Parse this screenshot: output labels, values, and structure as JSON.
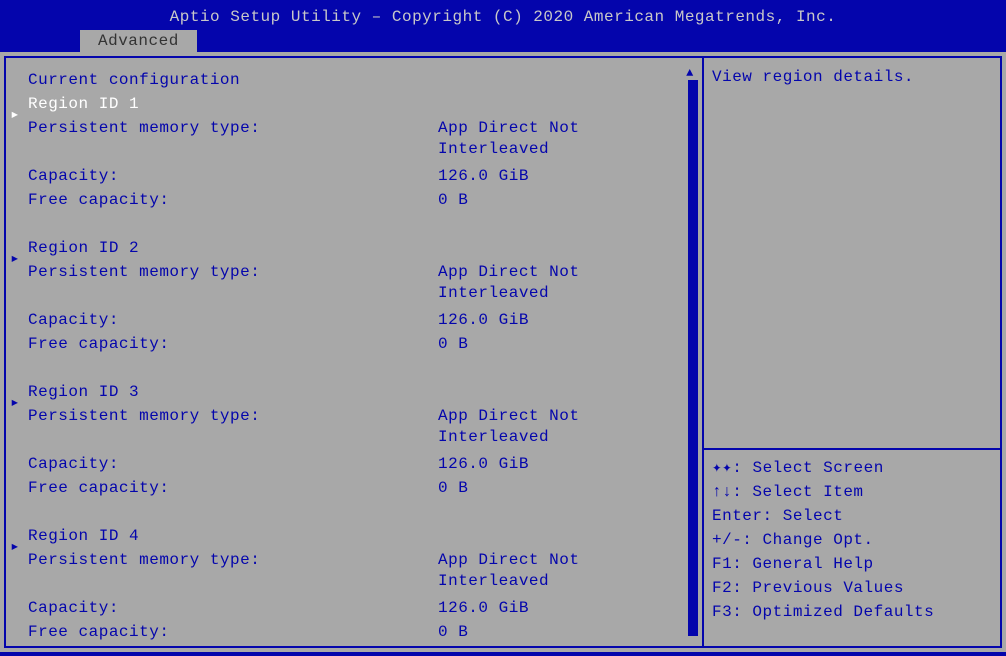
{
  "header": {
    "title": "Aptio Setup Utility – Copyright (C) 2020 American Megatrends, Inc."
  },
  "tab": {
    "label": "Advanced"
  },
  "content": {
    "section_title": "Current configuration",
    "regions": [
      {
        "id_label": "Region ID 1",
        "mem_type_label": "Persistent memory type:",
        "mem_type_value_l1": "App Direct Not",
        "mem_type_value_l2": "Interleaved",
        "capacity_label": "Capacity:",
        "capacity_value": "126.0 GiB",
        "free_label": "Free capacity:",
        "free_value": "0 B",
        "selected": true
      },
      {
        "id_label": "Region ID 2",
        "mem_type_label": "Persistent memory type:",
        "mem_type_value_l1": "App Direct Not",
        "mem_type_value_l2": "Interleaved",
        "capacity_label": "Capacity:",
        "capacity_value": "126.0 GiB",
        "free_label": "Free capacity:",
        "free_value": "0 B",
        "selected": false
      },
      {
        "id_label": "Region ID 3",
        "mem_type_label": "Persistent memory type:",
        "mem_type_value_l1": "App Direct Not",
        "mem_type_value_l2": "Interleaved",
        "capacity_label": "Capacity:",
        "capacity_value": "126.0 GiB",
        "free_label": "Free capacity:",
        "free_value": "0 B",
        "selected": false
      },
      {
        "id_label": "Region ID 4",
        "mem_type_label": "Persistent memory type:",
        "mem_type_value_l1": "App Direct Not",
        "mem_type_value_l2": "Interleaved",
        "capacity_label": "Capacity:",
        "capacity_value": "126.0 GiB",
        "free_label": "Free capacity:",
        "free_value": "0 B",
        "selected": false
      }
    ]
  },
  "help": {
    "description": "View region details.",
    "keys": [
      "✦✦: Select Screen",
      "↑↓: Select Item",
      "Enter: Select",
      "+/-: Change Opt.",
      "F1: General Help",
      "F2: Previous Values",
      "F3: Optimized Defaults"
    ]
  }
}
